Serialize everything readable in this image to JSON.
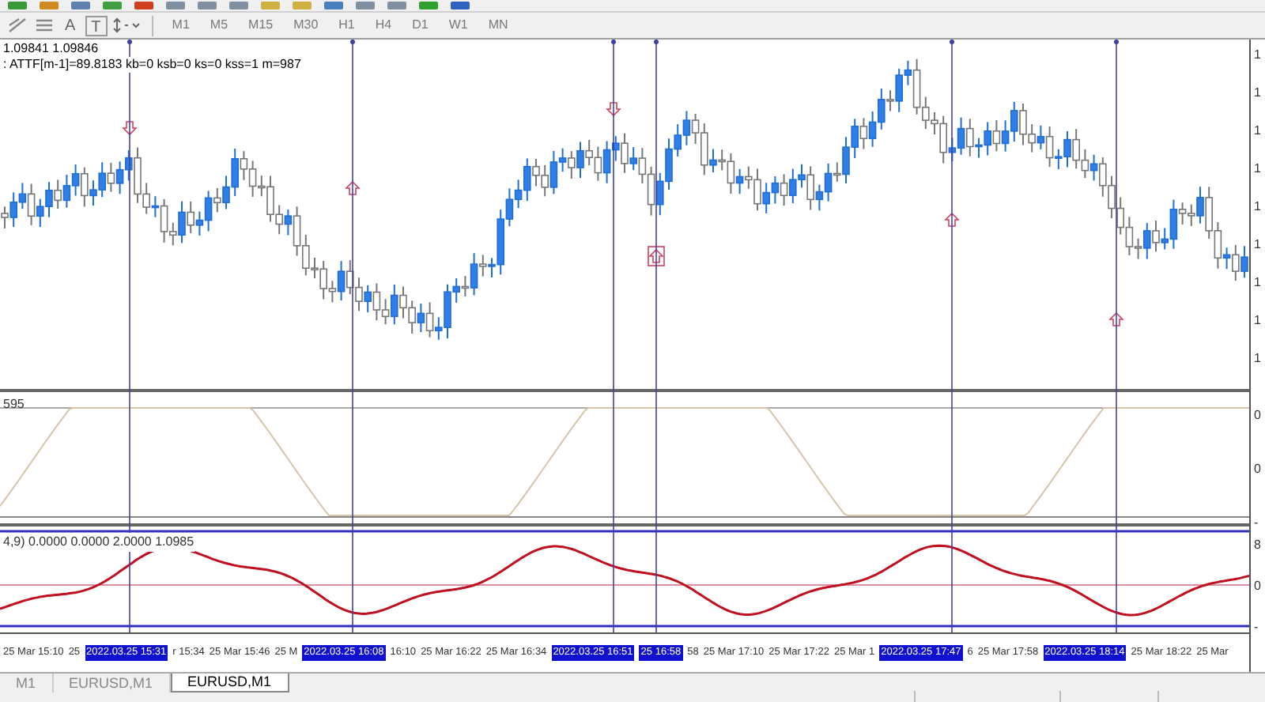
{
  "toolbar": {
    "text_tools": [
      "A",
      "T"
    ],
    "timeframes": [
      {
        "label": "M1"
      },
      {
        "label": "M5"
      },
      {
        "label": "M15"
      },
      {
        "label": "M30"
      },
      {
        "label": "H1"
      },
      {
        "label": "H4"
      },
      {
        "label": "D1"
      },
      {
        "label": "W1"
      },
      {
        "label": "MN"
      }
    ]
  },
  "chart": {
    "info_lines": [
      "1.09841 1.09846",
      ": ATTF[m-1]=89.8183 kb=0 ksb=0 ks=0 kss=1 m=987"
    ],
    "oscillator_label": "595",
    "indicator_label": "4,9) 0.0000 0.0000 2.0000 1.0985",
    "price_axis": [
      "1",
      "1",
      "1",
      "1",
      "1",
      "1",
      "1",
      "1",
      "1"
    ],
    "oscillator_axis": [
      "0",
      "0",
      "-"
    ],
    "indicator_axis": [
      "8",
      "0",
      "-"
    ],
    "time_axis": [
      {
        "kind": "time",
        "text": "25 Mar 15:10"
      },
      {
        "kind": "time",
        "text": "25"
      },
      {
        "kind": "marker",
        "text": "2022.03.25 15:31"
      },
      {
        "kind": "time",
        "text": "r 15:34"
      },
      {
        "kind": "time",
        "text": "25 Mar 15:46"
      },
      {
        "kind": "time",
        "text": "25 M"
      },
      {
        "kind": "marker",
        "text": "2022.03.25 16:08"
      },
      {
        "kind": "time",
        "text": "16:10"
      },
      {
        "kind": "time",
        "text": "25 Mar 16:22"
      },
      {
        "kind": "time",
        "text": "25 Mar 16:34"
      },
      {
        "kind": "marker",
        "text": "2022.03.25 16:51"
      },
      {
        "kind": "marker",
        "text": "25 16:58"
      },
      {
        "kind": "time",
        "text": "58"
      },
      {
        "kind": "time",
        "text": "25 Mar 17:10"
      },
      {
        "kind": "time",
        "text": "25 Mar 17:22"
      },
      {
        "kind": "time",
        "text": "25 Mar 1"
      },
      {
        "kind": "marker",
        "text": "2022.03.25 17:47"
      },
      {
        "kind": "time",
        "text": "6"
      },
      {
        "kind": "time",
        "text": "25 Mar 17:58"
      },
      {
        "kind": "marker",
        "text": "2022.03.25 18:14"
      },
      {
        "kind": "time",
        "text": "25 Mar 18:22"
      },
      {
        "kind": "time",
        "text": "25 Mar"
      }
    ]
  },
  "tabs": [
    {
      "label": "M1",
      "selected": false
    },
    {
      "label": "EURUSD,M1",
      "selected": false
    },
    {
      "label": "EURUSD,M1",
      "selected": true
    }
  ]
}
